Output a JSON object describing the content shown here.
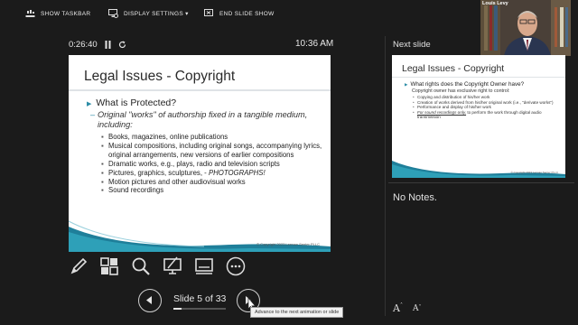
{
  "toolbar": {
    "show_taskbar": "SHOW TASKBAR",
    "display_settings": "DISPLAY SETTINGS ▾",
    "end_slide_show": "END SLIDE SHOW"
  },
  "video": {
    "name": "Louis Levy"
  },
  "timer": {
    "elapsed": "0:26:40",
    "clock": "10:36 AM"
  },
  "current_slide": {
    "title": "Legal Issues - Copyright",
    "bullet": "What is Protected?",
    "sub": "Original \"works\" of authorship fixed in a tangible medium, including:",
    "items": [
      "Books, magazines, online publications",
      "Musical compositions, including original songs, accompanying lyrics, original arrangements, new versions of earlier compositions",
      "Dramatic works, e.g., plays, radio and television scripts",
      "Motion pictures and other audiovisual works",
      "Sound recordings"
    ],
    "item_photo_prefix": "Pictures, graphics, sculptures, - ",
    "item_photo_em": "PHOTOGRAPHS!",
    "copyright": "© Copyright 2023 Lerman Senter PLLC"
  },
  "next": {
    "label": "Next slide",
    "title": "Legal Issues - Copyright",
    "bullet": "What rights does the Copyright Owner have?",
    "sub": "Copyright owner has exclusive right to control:",
    "items": [
      "Copying and distribution of his/her work",
      "Creation of works derived from his/her original work (i.e., \"derivate works\")",
      "Performance and display of his/her work"
    ],
    "item_sound_u": "For sound recordings only,",
    "item_sound_rest": " to perform the work through digital audio transmission",
    "copyright": "© Copyright 2023 Lerman Senter PLLC"
  },
  "notes": {
    "text": "No Notes."
  },
  "font": {
    "up": "A",
    "down": "A"
  },
  "nav": {
    "counter": "Slide 5 of 33",
    "current": 5,
    "total": 33,
    "tooltip": "Advance to the next animation or slide"
  },
  "icons": [
    "taskbar-icon",
    "display-icon",
    "end-show-icon",
    "pause-icon",
    "reset-icon",
    "pen-icon",
    "all-slides-icon",
    "zoom-icon",
    "pointer-icon",
    "subtitle-icon",
    "more-icon",
    "prev-icon",
    "next-icon"
  ],
  "colors": {
    "background": "#1b1b1b",
    "accent": "#2b8ca6"
  }
}
